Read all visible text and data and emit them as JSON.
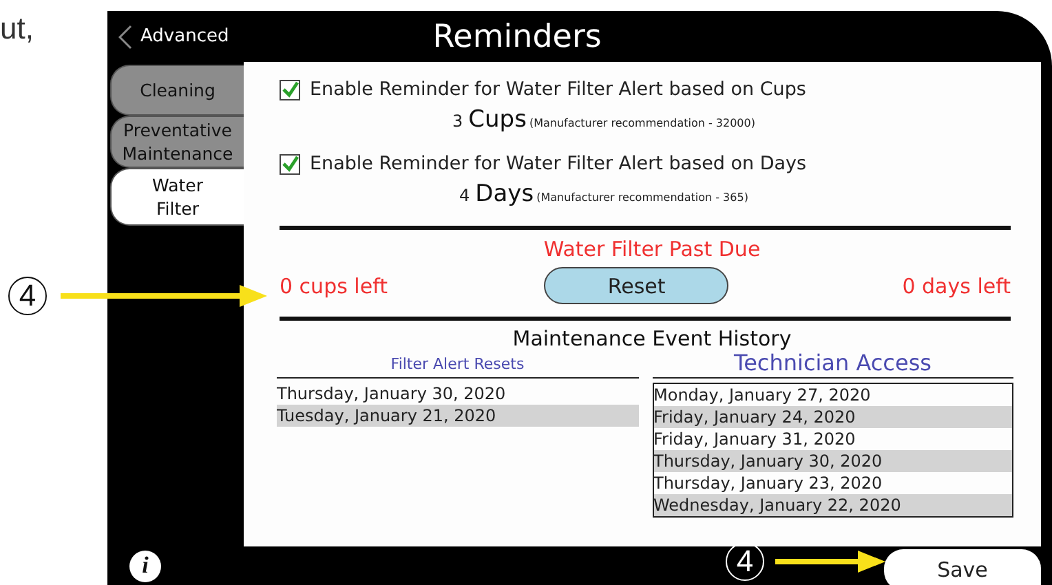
{
  "manual_text": "ut,",
  "header": {
    "back_label": "Advanced",
    "title": "Reminders"
  },
  "sidebar": {
    "tabs": [
      {
        "label": "Cleaning",
        "selected": false
      },
      {
        "label": "Preventative Maintenance",
        "selected": false
      },
      {
        "label": "Water Filter",
        "selected": true
      }
    ]
  },
  "reminders": [
    {
      "label": "Enable Reminder for Water Filter Alert based on Cups",
      "checked": true,
      "value": "3",
      "unit": "Cups",
      "note": "(Manufacturer recommendation - 32000)"
    },
    {
      "label": "Enable Reminder for Water Filter Alert based on Days",
      "checked": true,
      "value": "4",
      "unit": "Days",
      "note": "(Manufacturer recommendation - 365)"
    }
  ],
  "status": {
    "title": "Water Filter Past Due",
    "cups_left": "0 cups left",
    "reset_button": "Reset",
    "days_left": "0 days left"
  },
  "history": {
    "title": "Maintenance Event History",
    "filter_alert_resets": {
      "heading": "Filter Alert Resets",
      "rows": [
        "Thursday, January 30, 2020",
        "Tuesday, January 21, 2020"
      ]
    },
    "technician_access": {
      "heading": "Technician Access",
      "rows": [
        "Monday, January 27, 2020",
        "Friday, January 24, 2020",
        "Friday, January 31, 2020",
        "Thursday, January 30, 2020",
        "Thursday, January 23, 2020",
        "Wednesday, January 22, 2020"
      ]
    }
  },
  "footer": {
    "info_label": "i",
    "save_button": "Save"
  },
  "callouts": [
    {
      "number": "4"
    },
    {
      "number": "4"
    }
  ]
}
